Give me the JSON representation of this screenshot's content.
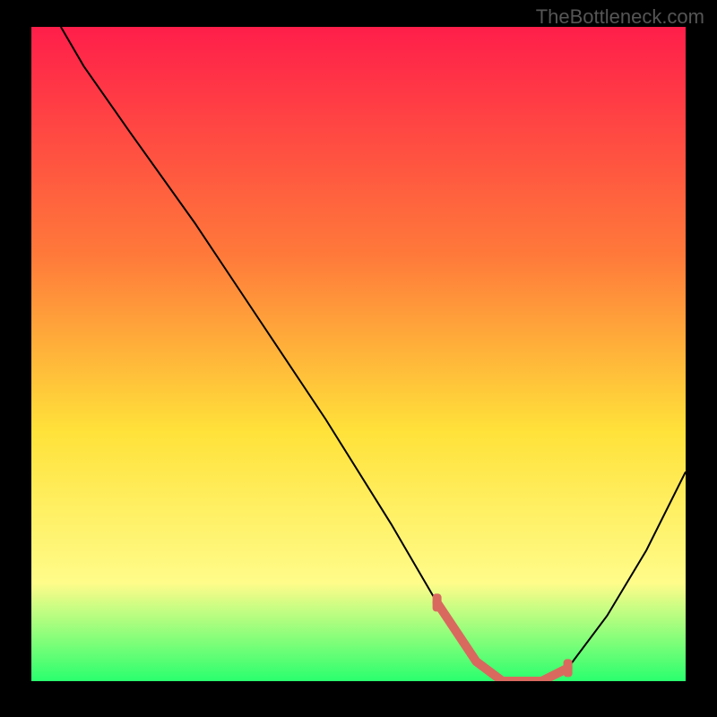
{
  "watermark": "TheBottleneck.com",
  "colors": {
    "bg_black": "#000000",
    "grad_top": "#ff1e4a",
    "grad_mid1": "#ff7a3a",
    "grad_mid2": "#ffe23a",
    "grad_mid3": "#fffc8a",
    "grad_bottom": "#2aff6e",
    "curve": "#000000",
    "highlight": "#d9695f"
  },
  "chart_data": {
    "type": "line",
    "title": "",
    "xlabel": "",
    "ylabel": "",
    "xlim": [
      0,
      100
    ],
    "ylim": [
      0,
      100
    ],
    "series": [
      {
        "name": "curve",
        "x": [
          4.5,
          8,
          15,
          25,
          35,
          45,
          55,
          62,
          68,
          72,
          78,
          82,
          88,
          94,
          100
        ],
        "values": [
          100,
          94,
          84,
          70,
          55,
          40,
          24,
          12,
          3,
          0,
          0,
          2,
          10,
          20,
          32
        ]
      }
    ],
    "highlight_segment": {
      "x": [
        62,
        68,
        72,
        78,
        82
      ],
      "values": [
        12,
        3,
        0,
        0,
        2
      ],
      "caps": [
        {
          "x": 62,
          "y": 12
        },
        {
          "x": 82,
          "y": 2
        }
      ]
    }
  }
}
